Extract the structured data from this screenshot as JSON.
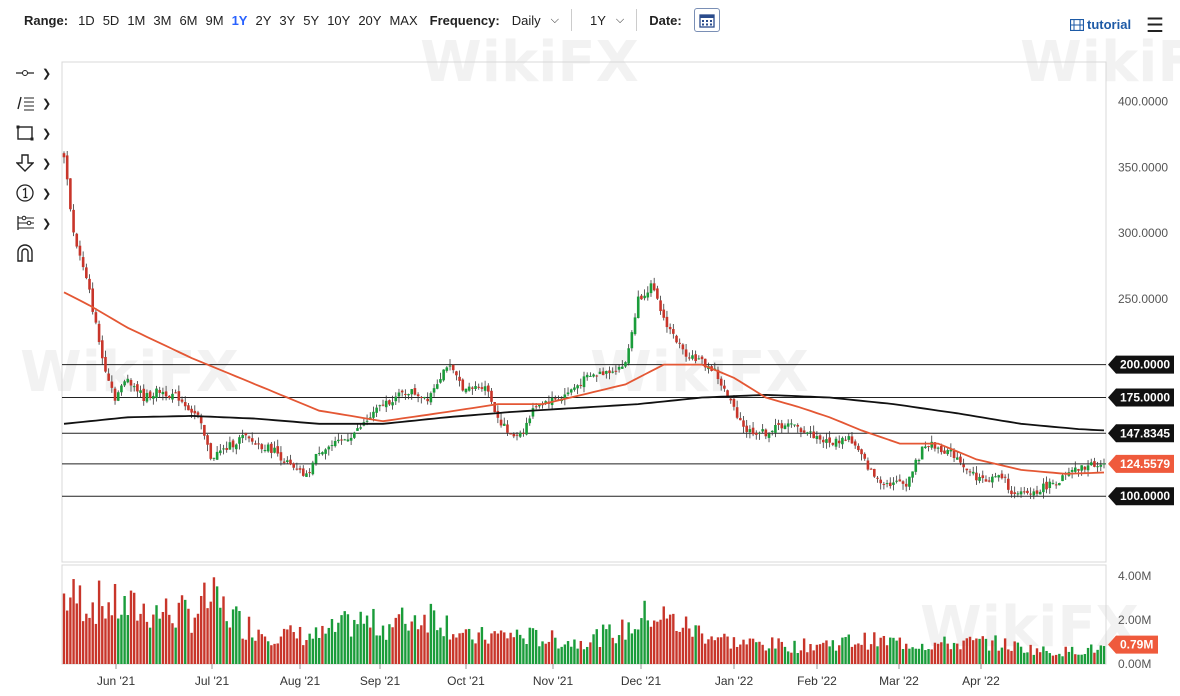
{
  "toolbar": {
    "range_label": "Range:",
    "ranges": [
      "1D",
      "5D",
      "1M",
      "3M",
      "6M",
      "9M",
      "1Y",
      "2Y",
      "3Y",
      "5Y",
      "10Y",
      "20Y",
      "MAX"
    ],
    "active_range": "1Y",
    "frequency_label": "Frequency:",
    "frequency_value": "Daily",
    "period_value": "1Y",
    "date_label": "Date:",
    "tutorial_label": "tutorial"
  },
  "icons": {
    "tools": [
      "crosshair-icon",
      "trend-line-icon",
      "rectangle-icon",
      "down-arrow-icon",
      "circle-one-icon",
      "fib-icon",
      "magnet-icon"
    ],
    "calendar": "calendar-icon",
    "menu": "hamburger-menu-icon"
  },
  "colors": {
    "up": "#1a9c3a",
    "down": "#c8352a",
    "ma_fast": "#e45734",
    "ma_slow": "#111111",
    "last_price_bg": "#ef5a3c",
    "level_bg": "#111111",
    "accent": "#2962ff"
  },
  "chart_data": {
    "type": "candlestick",
    "price_axis": {
      "ylim": [
        50,
        430
      ],
      "ticks": [
        400,
        350,
        300,
        250
      ],
      "tick_labels": [
        "400.0000",
        "350.0000",
        "300.0000",
        "250.0000"
      ]
    },
    "x_axis_labels": [
      "Jun '21",
      "Jul '21",
      "Aug '21",
      "Sep '21",
      "Oct '21",
      "Nov '21",
      "Dec '21",
      "Jan '22",
      "Feb '22",
      "Mar '22",
      "Apr '22"
    ],
    "horizontal_levels": [
      {
        "value": 200,
        "label": "200.0000"
      },
      {
        "value": 175,
        "label": "175.0000"
      },
      {
        "value": 147.8345,
        "label": "147.8345"
      },
      {
        "value": 124.5579,
        "label": "124.5579",
        "last_price": true
      },
      {
        "value": 100,
        "label": "100.0000"
      }
    ],
    "close_anchors": [
      [
        0,
        360
      ],
      [
        3,
        300
      ],
      [
        8,
        255
      ],
      [
        12,
        205
      ],
      [
        16,
        175
      ],
      [
        20,
        190
      ],
      [
        25,
        175
      ],
      [
        30,
        180
      ],
      [
        36,
        175
      ],
      [
        42,
        160
      ],
      [
        46,
        130
      ],
      [
        50,
        135
      ],
      [
        56,
        145
      ],
      [
        60,
        140
      ],
      [
        66,
        135
      ],
      [
        72,
        120
      ],
      [
        76,
        115
      ],
      [
        80,
        135
      ],
      [
        86,
        140
      ],
      [
        92,
        150
      ],
      [
        100,
        170
      ],
      [
        108,
        180
      ],
      [
        114,
        175
      ],
      [
        120,
        200
      ],
      [
        126,
        180
      ],
      [
        132,
        185
      ],
      [
        136,
        160
      ],
      [
        140,
        145
      ],
      [
        144,
        150
      ],
      [
        148,
        170
      ],
      [
        156,
        175
      ],
      [
        164,
        190
      ],
      [
        170,
        195
      ],
      [
        176,
        200
      ],
      [
        180,
        250
      ],
      [
        184,
        260
      ],
      [
        188,
        235
      ],
      [
        194,
        210
      ],
      [
        198,
        205
      ],
      [
        204,
        195
      ],
      [
        208,
        175
      ],
      [
        214,
        150
      ],
      [
        220,
        148
      ],
      [
        226,
        155
      ],
      [
        232,
        150
      ],
      [
        240,
        140
      ],
      [
        246,
        145
      ],
      [
        250,
        130
      ],
      [
        254,
        115
      ],
      [
        258,
        110
      ],
      [
        264,
        110
      ],
      [
        270,
        140
      ],
      [
        276,
        135
      ],
      [
        280,
        130
      ],
      [
        284,
        118
      ],
      [
        288,
        112
      ],
      [
        294,
        115
      ],
      [
        298,
        100
      ],
      [
        304,
        103
      ],
      [
        308,
        108
      ],
      [
        312,
        112
      ],
      [
        316,
        118
      ],
      [
        320,
        122
      ],
      [
        324,
        125
      ],
      [
        326,
        124.56
      ]
    ],
    "ma_fast": [
      [
        0,
        255
      ],
      [
        8,
        245
      ],
      [
        20,
        228
      ],
      [
        40,
        205
      ],
      [
        60,
        185
      ],
      [
        80,
        165
      ],
      [
        100,
        157
      ],
      [
        120,
        164
      ],
      [
        136,
        170
      ],
      [
        150,
        170
      ],
      [
        164,
        178
      ],
      [
        176,
        185
      ],
      [
        188,
        200
      ],
      [
        200,
        200
      ],
      [
        210,
        190
      ],
      [
        220,
        175
      ],
      [
        230,
        168
      ],
      [
        240,
        160
      ],
      [
        250,
        150
      ],
      [
        262,
        140
      ],
      [
        274,
        140
      ],
      [
        286,
        128
      ],
      [
        300,
        120
      ],
      [
        314,
        117
      ],
      [
        326,
        118
      ]
    ],
    "ma_slow": [
      [
        0,
        155
      ],
      [
        20,
        160
      ],
      [
        40,
        161
      ],
      [
        60,
        159
      ],
      [
        80,
        155
      ],
      [
        100,
        155
      ],
      [
        120,
        160
      ],
      [
        140,
        164
      ],
      [
        160,
        167
      ],
      [
        180,
        170
      ],
      [
        200,
        175
      ],
      [
        220,
        177
      ],
      [
        240,
        175
      ],
      [
        260,
        170
      ],
      [
        280,
        163
      ],
      [
        300,
        155
      ],
      [
        318,
        151
      ],
      [
        326,
        150
      ]
    ],
    "volume_axis": {
      "ylim": [
        0,
        4.5
      ],
      "tick_labels": [
        "4.00M",
        "2.00M",
        "0.00M"
      ],
      "last_volume_label": "0.79M"
    },
    "volume_profile": [
      [
        0,
        3.4
      ],
      [
        14,
        3.0
      ],
      [
        20,
        2.8
      ],
      [
        40,
        2.5
      ],
      [
        46,
        3.3
      ],
      [
        56,
        2.0
      ],
      [
        66,
        1.5
      ],
      [
        80,
        1.4
      ],
      [
        92,
        2.2
      ],
      [
        100,
        1.9
      ],
      [
        116,
        2.6
      ],
      [
        126,
        1.3
      ],
      [
        140,
        1.5
      ],
      [
        160,
        1.1
      ],
      [
        176,
        1.7
      ],
      [
        184,
        2.6
      ],
      [
        196,
        1.8
      ],
      [
        210,
        1.1
      ],
      [
        230,
        0.9
      ],
      [
        250,
        1.2
      ],
      [
        272,
        1.0
      ],
      [
        290,
        1.1
      ],
      [
        310,
        0.6
      ],
      [
        326,
        0.79
      ]
    ]
  }
}
